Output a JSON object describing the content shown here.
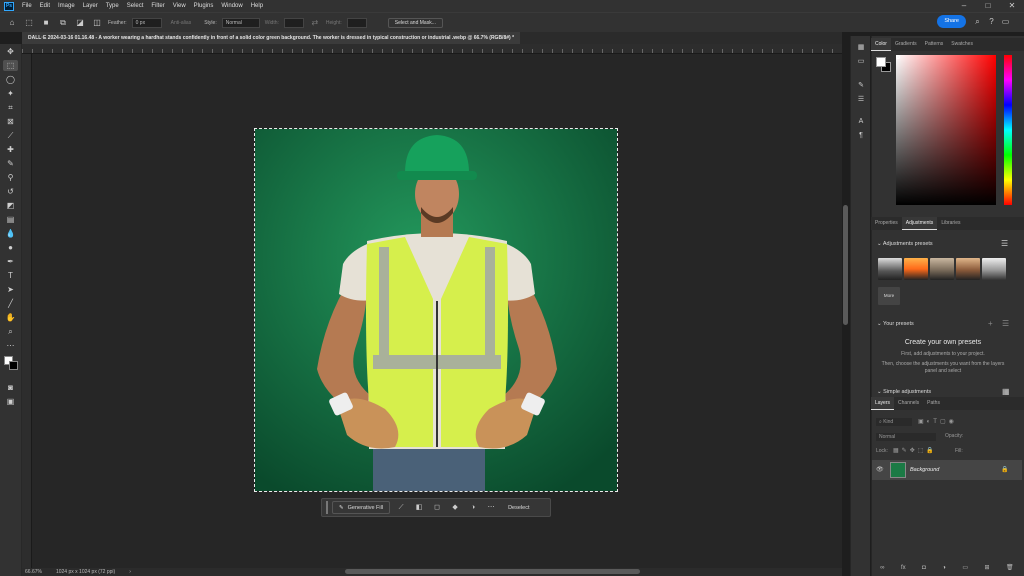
{
  "menubar": {
    "logo": "Ps",
    "items": [
      "File",
      "Edit",
      "Image",
      "Layer",
      "Type",
      "Select",
      "Filter",
      "View",
      "Plugins",
      "Window",
      "Help"
    ],
    "window_controls": [
      "–",
      "□",
      "✕"
    ]
  },
  "options_bar": {
    "feather_label": "Feather:",
    "feather_value": "0 px",
    "antialias_label": "Anti-alias",
    "style_label": "Style:",
    "style_value": "Normal",
    "width_label": "Width:",
    "height_label": "Height:",
    "select_mask_label": "Select and Mask..."
  },
  "share_label": "Share",
  "document_tab": {
    "title": "DALL·E 2024-03-16 01.16.48 - A worker wearing a hardhat stands confidently in front of a solid color green background. The worker is dressed in typical construction or industrial .webp @ 66.7% (RGB/8#) *"
  },
  "context_bar": {
    "generative_fill": "Generative Fill",
    "deselect": "Deselect"
  },
  "status_bar": {
    "zoom": "66.67%",
    "doc_size": "1024 px x 1024 px (72 ppi)"
  },
  "color_panel": {
    "tabs": [
      "Color",
      "Gradients",
      "Patterns",
      "Swatches"
    ],
    "active_tab": "Color",
    "foreground": "#ffffff",
    "background": "#000000"
  },
  "adjustments_panel": {
    "tabs": [
      "Properties",
      "Adjustments",
      "Libraries"
    ],
    "active_tab": "Adjustments",
    "presets_heading": "Adjustments presets",
    "more_label": "More",
    "your_presets_heading": "Your presets",
    "create_title": "Create your own presets",
    "create_desc_1": "First, add adjustments to your project.",
    "create_desc_2": "Then, choose the adjustments you want from the layers panel and select",
    "simple_heading": "Simple adjustments"
  },
  "layers_panel": {
    "tabs": [
      "Layers",
      "Channels",
      "Paths"
    ],
    "active_tab": "Layers",
    "kind_placeholder": "Kind",
    "blend_mode": "Normal",
    "opacity_label": "Opacity:",
    "lock_label": "Lock:",
    "fill_label": "Fill:",
    "layer_name": "Background"
  }
}
